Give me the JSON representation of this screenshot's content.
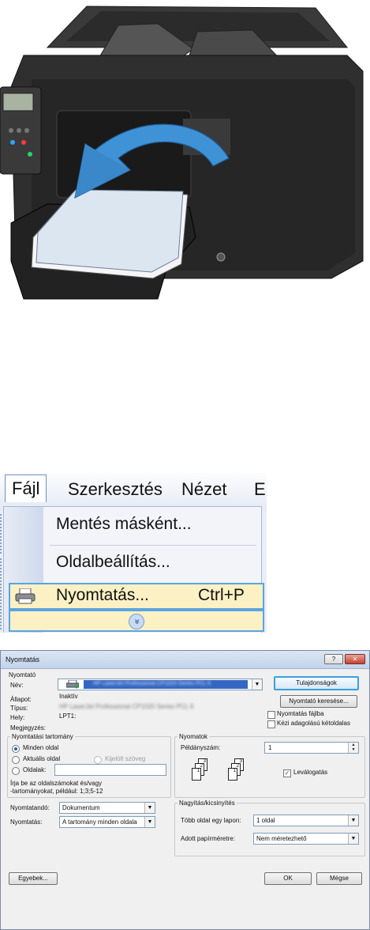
{
  "menu": {
    "bar": {
      "file": "Fájl",
      "edit": "Szerkesztés",
      "view": "Nézet",
      "next": "E"
    },
    "items": {
      "save_as": "Mentés másként...",
      "page_setup": "Oldalbeállítás...",
      "print": "Nyomtatás...",
      "print_shortcut": "Ctrl+P"
    },
    "expand_glyph": "»"
  },
  "dialog": {
    "title": "Nyomtatás",
    "help_glyph": "?",
    "close_glyph": "✕",
    "printer_group": "Nyomtató",
    "name_label": "Név:",
    "printer_name": "HP LaserJet Professional CP1020 Series PCL 6",
    "status_label": "Állapot:",
    "status_value": "Inaktív",
    "type_label": "Típus:",
    "type_value": "HP LaserJet Professional CP1020 Series PCL 6",
    "where_label": "Hely:",
    "where_value": "LPT1:",
    "comment_label": "Megjegyzés:",
    "properties_button": "Tulajdonságok",
    "find_printer_button": "Nyomtató keresése...",
    "print_to_file": "Nyomtatás fájlba",
    "manual_duplex": "Kézi adagolású kétoldalas",
    "range_group": "Nyomtatási tartomány",
    "range_all": "Minden oldal",
    "range_current": "Aktuális oldal",
    "range_selection": "Kijelölt szöveg",
    "range_pages": "Oldalak:",
    "range_hint_1": "Írja be az oldalszámokat és/vagy",
    "range_hint_2": "-tartományokat, például: 1;3;5-12",
    "copies_group": "Nyomatok",
    "copies_label": "Példányszám:",
    "copies_value": "1",
    "collate_label": "Leválogatás",
    "print_what_label": "Nyomtatandó:",
    "print_what_value": "Dokumentum",
    "print_label": "Nyomtatás:",
    "print_value": "A tartomány minden oldala",
    "zoom_group": "Nagyítás/kicsinyítés",
    "pages_per_sheet_label": "Több oldal egy lapon:",
    "pages_per_sheet_value": "1 oldal",
    "scale_label": "Adott papírméretre:",
    "scale_value": "Nem méretezhető",
    "options_button": "Egyebek...",
    "ok_button": "OK",
    "cancel_button": "Mégse",
    "collate_pages": [
      "3",
      "2",
      "1",
      "3",
      "2",
      "1"
    ]
  }
}
